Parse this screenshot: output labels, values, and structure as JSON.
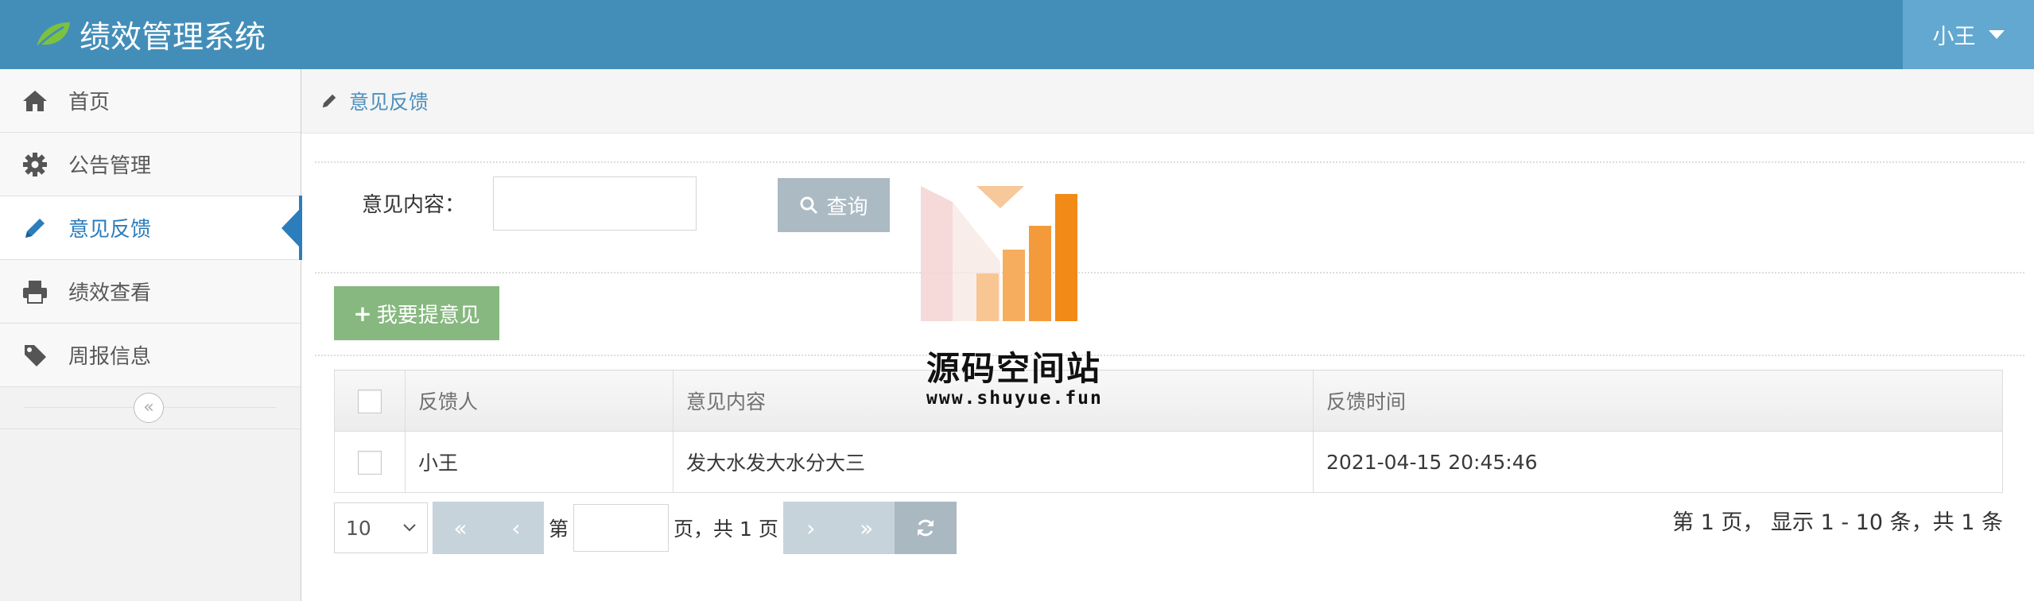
{
  "header": {
    "title": "绩效管理系统",
    "user": "小王"
  },
  "sidebar": {
    "items": [
      {
        "label": "首页"
      },
      {
        "label": "公告管理"
      },
      {
        "label": "意见反馈",
        "active": true
      },
      {
        "label": "绩效查看"
      },
      {
        "label": "周报信息"
      }
    ],
    "collapse_glyph": "«"
  },
  "breadcrumb": {
    "label": "意见反馈"
  },
  "search": {
    "label": "意见内容：",
    "value": "",
    "button": "查询"
  },
  "toolbar": {
    "add_button": "我要提意见"
  },
  "table": {
    "headers": [
      "反馈人",
      "意见内容",
      "反馈时间"
    ],
    "rows": [
      {
        "person": "小王",
        "content": "发大水发大水分大三",
        "time": "2021-04-15 20:45:46"
      }
    ]
  },
  "pager": {
    "page_size": "10",
    "first": "«",
    "prev": "‹",
    "next": "›",
    "last": "»",
    "page_prefix": "第",
    "page_input": "",
    "page_suffix": "页，共 1 页",
    "info": "第 1 页， 显示 1 - 10 条，共 1 条"
  },
  "watermark": {
    "title": "源码空间站",
    "url": "www.shuyue.fun"
  },
  "colors": {
    "header": "#438eb9",
    "user_menu": "#62a8d1",
    "active": "#2b7dbc",
    "query_button": "#abbac3",
    "add_button": "#87b87f"
  }
}
